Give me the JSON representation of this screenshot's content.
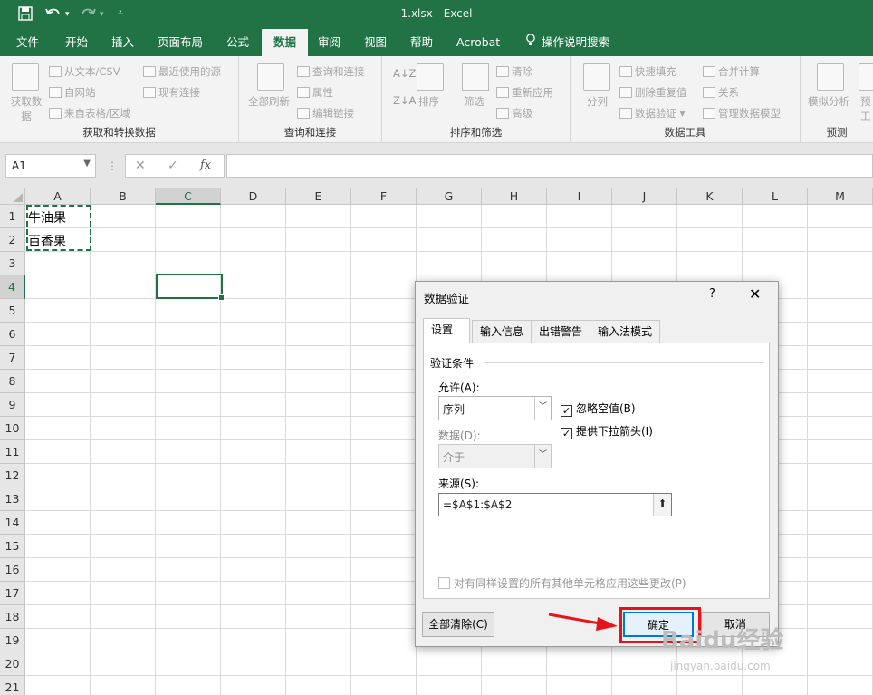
{
  "window": {
    "title": "1.xlsx  -  Excel"
  },
  "quick_access": {
    "icons": [
      "save-icon",
      "undo-icon",
      "redo-icon",
      "customize-icon"
    ]
  },
  "ribbon_tabs": [
    "文件",
    "开始",
    "插入",
    "页面布局",
    "公式",
    "数据",
    "审阅",
    "视图",
    "帮助",
    "Acrobat",
    "操作说明搜索"
  ],
  "active_tab": "数据",
  "ribbon": {
    "get_data": {
      "big_button_line1": "获取数",
      "big_button_line2": "据",
      "from_text": "从文本/CSV",
      "from_web": "自网站",
      "from_table": "来自表格/区域",
      "recent_sources": "最近使用的源",
      "existing_connections": "现有连接",
      "group_label": "获取和转换数据"
    },
    "queries": {
      "refresh_all": "全部刷新",
      "queries_connections": "查询和连接",
      "properties": "属性",
      "edit_links": "编辑链接",
      "group_label": "查询和连接"
    },
    "sort_filter": {
      "sort": "排序",
      "filter": "筛选",
      "clear": "清除",
      "reapply": "重新应用",
      "advanced": "高级",
      "group_label": "排序和筛选"
    },
    "data_tools": {
      "split": "分列",
      "flash_fill": "快速填充",
      "remove_duplicates": "删除重复值",
      "data_validation": "数据验证",
      "consolidate": "合并计算",
      "relationships": "关系",
      "manage_model": "管理数据模型",
      "group_label": "数据工具"
    },
    "forecast": {
      "what_if": "模拟分析",
      "forecast_sheet_partial": "预",
      "forecast_sheet_partial2": "工",
      "group_label": "预测"
    }
  },
  "formula_bar": {
    "name_box": "A1",
    "fx": "fx",
    "formula": ""
  },
  "sheet": {
    "columns": [
      "A",
      "B",
      "C",
      "D",
      "E",
      "F",
      "G",
      "H",
      "I",
      "J",
      "K",
      "L",
      "M"
    ],
    "rows": [
      "1",
      "2",
      "3",
      "4",
      "5",
      "6",
      "7",
      "8",
      "9",
      "10",
      "11",
      "12",
      "13",
      "14",
      "15",
      "16",
      "17",
      "18",
      "19",
      "20",
      "21"
    ],
    "cells": {
      "A1": "牛油果",
      "A2": "百香果"
    },
    "selected_column": "C",
    "selected_row": "4"
  },
  "dialog": {
    "title": "数据验证",
    "help": "?",
    "close": "✕",
    "tabs": [
      "设置",
      "输入信息",
      "出错警告",
      "输入法模式"
    ],
    "active_tab": "设置",
    "section_title": "验证条件",
    "allow_label": "允许(A):",
    "allow_value": "序列",
    "data_label": "数据(D):",
    "data_value": "介于",
    "ignore_blank": "忽略空值(B)",
    "ignore_blank_checked": true,
    "in_cell_dropdown": "提供下拉箭头(I)",
    "in_cell_dropdown_checked": true,
    "source_label": "来源(S):",
    "source_value": "=$A$1:$A$2",
    "apply_all": "对有同样设置的所有其他单元格应用这些更改(P)",
    "apply_all_checked": false,
    "clear_all": "全部清除(C)",
    "ok": "确定",
    "cancel": "取消"
  },
  "watermark": {
    "line1": "Baidu经验",
    "line2": "jingyan.baidu.com"
  },
  "colors": {
    "excel_green": "#217346",
    "highlight_red": "#e8121a",
    "focus_blue": "#0078d7"
  }
}
